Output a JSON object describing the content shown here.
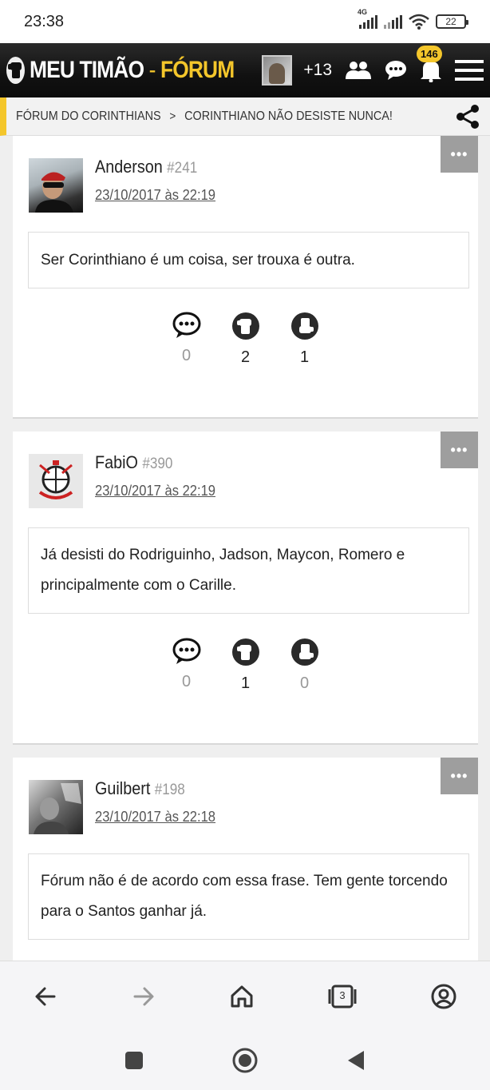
{
  "status": {
    "time": "23:38",
    "network": "4G",
    "battery": "22"
  },
  "header": {
    "logo_main": "MEU TIMÃO",
    "logo_sep": " - ",
    "logo_forum": "FÓRUM",
    "online_extra": "+13",
    "notification_count": "146"
  },
  "breadcrumb": {
    "items": [
      "FÓRUM DO CORINTHIANS",
      "CORINTHIANO NÃO DESISTE NUNCA!"
    ],
    "separator": ">"
  },
  "posts": [
    {
      "user": "Anderson",
      "rank": "#241",
      "date": "23/10/2017 às 22:19",
      "body": "Ser Corinthiano é um coisa, ser trouxa é outra.",
      "replies": "0",
      "likes": "2",
      "dislikes": "1"
    },
    {
      "user": "FabiO",
      "rank": "#390",
      "date": "23/10/2017 às 22:19",
      "body": "Já desisti do Rodriguinho, Jadson, Maycon, Romero e principalmente com o Carille.",
      "replies": "0",
      "likes": "1",
      "dislikes": "0"
    },
    {
      "user": "Guilbert",
      "rank": "#198",
      "date": "23/10/2017 às 22:18",
      "body": "Fórum não é de acordo com essa frase. Tem gente torcendo para o Santos ganhar já.",
      "replies": "",
      "likes": "",
      "dislikes": ""
    }
  ],
  "browser": {
    "tab_count": "3"
  },
  "icons": [
    "fist-logo-icon",
    "users-icon",
    "chat-icon",
    "bell-icon",
    "menu-icon",
    "share-icon",
    "reply-icon",
    "like-fist-icon",
    "dislike-fist-icon",
    "back-icon",
    "forward-icon",
    "home-icon",
    "tabs-icon",
    "account-icon"
  ],
  "colors": {
    "accent": "#f4c62b",
    "header_bg": "#111111",
    "more_button": "#9e9e9e"
  }
}
